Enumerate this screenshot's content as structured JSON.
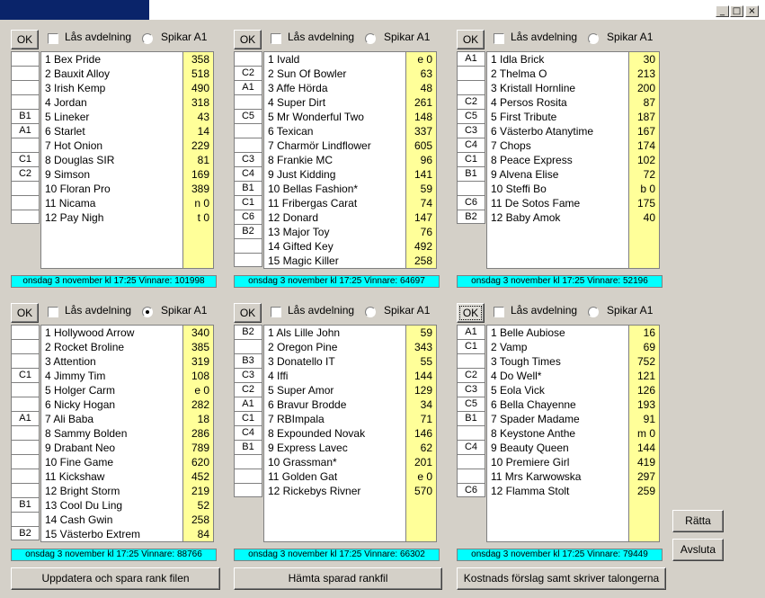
{
  "window": {
    "minimize": "_",
    "maximize": "□",
    "close": "×"
  },
  "panels": [
    {
      "ok": "OK",
      "lock": "Lås avdelning",
      "radio": "Spikar A1",
      "radio_on": false,
      "codes": [
        "",
        "",
        "",
        "",
        "B1",
        "A1",
        "",
        "C1",
        "C2",
        "",
        "",
        ""
      ],
      "horses": [
        "1 Bex Pride",
        "2 Bauxit Alloy",
        "3 Irish Kemp",
        "4 Jordan",
        "5 Lineker",
        "6 Starlet",
        "7 Hot Onion",
        "8 Douglas SIR",
        "9 Simson",
        "10 Floran Pro",
        "11 Nicama",
        "12 Pay Nigh"
      ],
      "values": [
        "358",
        "518",
        "490",
        "318",
        "43",
        "14",
        "229",
        "81",
        "169",
        "389",
        "n 0",
        "t 0"
      ],
      "status": "onsdag 3 november kl 17:25 Vinnare: 101998"
    },
    {
      "ok": "OK",
      "lock": "Lås avdelning",
      "radio": "Spikar A1",
      "radio_on": false,
      "codes": [
        "",
        "C2",
        "A1",
        "",
        "C5",
        "",
        "",
        "C3",
        "C4",
        "B1",
        "C1",
        "C6",
        "B2",
        "",
        ""
      ],
      "horses": [
        "1 Ivald",
        "2 Sun Of Bowler",
        "3 Affe Hörda",
        "4 Super Dirt",
        "5 Mr Wonderful Two",
        "6 Texican",
        "7 Charmör Lindflower",
        "8 Frankie MC",
        "9 Just Kidding",
        "10 Bellas Fashion*",
        "11 Fribergas Carat",
        "12 Donard",
        "13 Major Toy",
        "14 Gifted Key",
        "15 Magic Killer"
      ],
      "values": [
        "e 0",
        "63",
        "48",
        "261",
        "148",
        "337",
        "605",
        "96",
        "141",
        "59",
        "74",
        "147",
        "76",
        "492",
        "258"
      ],
      "status": "onsdag 3 november kl 17:25 Vinnare: 64697"
    },
    {
      "ok": "OK",
      "lock": "Lås avdelning",
      "radio": "Spikar A1",
      "radio_on": false,
      "codes": [
        "A1",
        "",
        "",
        "C2",
        "C5",
        "C3",
        "C4",
        "C1",
        "B1",
        "",
        "C6",
        "B2"
      ],
      "horses": [
        "1 Idla Brick",
        "2 Thelma O",
        "3 Kristall Hornline",
        "4 Persos Rosita",
        "5 First Tribute",
        "6 Västerbo Atanytime",
        "7 Chops",
        "8 Peace Express",
        "9 Alvena Elise",
        "10 Steffi Bo",
        "11 De Sotos Fame",
        "12 Baby Amok"
      ],
      "values": [
        "30",
        "213",
        "200",
        "87",
        "187",
        "167",
        "174",
        "102",
        "72",
        "b 0",
        "175",
        "40"
      ],
      "status": "onsdag 3 november kl 17:25 Vinnare: 52196"
    },
    {
      "ok": "OK",
      "lock": "Lås avdelning",
      "radio": "Spikar A1",
      "radio_on": true,
      "codes": [
        "",
        "",
        "",
        "C1",
        "",
        "",
        "A1",
        "",
        "",
        "",
        "",
        "",
        "B1",
        "",
        "B2"
      ],
      "horses": [
        "1 Hollywood Arrow",
        "2 Rocket Broline",
        "3 Attention",
        "4 Jimmy Tim",
        "5 Holger Carm",
        "6 Nicky Hogan",
        "7 Ali Baba",
        "8 Sammy Bolden",
        "9 Drabant Neo",
        "10 Fine Game",
        "11 Kickshaw",
        "12 Bright Storm",
        "13 Cool Du Ling",
        "14 Cash Gwin",
        "15 Västerbo Extrem"
      ],
      "values": [
        "340",
        "385",
        "319",
        "108",
        "e 0",
        "282",
        "18",
        "286",
        "789",
        "620",
        "452",
        "219",
        "52",
        "258",
        "84"
      ],
      "status": "onsdag 3 november kl 17:25 Vinnare: 88766"
    },
    {
      "ok": "OK",
      "lock": "Lås avdelning",
      "radio": "Spikar A1",
      "radio_on": false,
      "codes": [
        "B2",
        "",
        "B3",
        "C3",
        "C2",
        "A1",
        "C1",
        "C4",
        "B1",
        "",
        "",
        ""
      ],
      "horses": [
        "1 Als Lille John",
        "2 Oregon Pine",
        "3 Donatello IT",
        "4 Iffi",
        "5 Super Amor",
        "6 Bravur Brodde",
        "7 RBImpala",
        "8 Expounded Novak",
        "9 Express Lavec",
        "10 Grassman*",
        "11 Golden Gat",
        "12 Rickebys Rivner"
      ],
      "values": [
        "59",
        "343",
        "55",
        "144",
        "129",
        "34",
        "71",
        "146",
        "62",
        "201",
        "e 0",
        "570"
      ],
      "status": "onsdag 3 november kl 17:25 Vinnare: 66302"
    },
    {
      "ok": "OK",
      "lock": "Lås avdelning",
      "radio": "Spikar A1",
      "radio_on": false,
      "codes": [
        "A1",
        "C1",
        "",
        "C2",
        "C3",
        "C5",
        "B1",
        "",
        "C4",
        "",
        "",
        "C6"
      ],
      "horses": [
        "1 Belle Aubiose",
        "2 Vamp",
        "3 Tough Times",
        "4 Do Well*",
        "5 Eola Vick",
        "6 Bella Chayenne",
        "7 Spader Madame",
        "8 Keystone Anthe",
        "9 Beauty Queen",
        "10 Premiere Girl",
        "11 Mrs Karwowska",
        "12 Flamma Stolt"
      ],
      "values": [
        "16",
        "69",
        "752",
        "121",
        "126",
        "193",
        "91",
        "m 0",
        "144",
        "419",
        "297",
        "259"
      ],
      "status": "onsdag 3 november kl 17:25 Vinnare: 79449"
    }
  ],
  "buttons": {
    "update": "Uppdatera och spara rank filen",
    "fetch": "Hämta sparad rankfil",
    "cost": "Kostnads förslag samt skriver talongerna",
    "fix": "Rätta",
    "quit": "Avsluta"
  }
}
